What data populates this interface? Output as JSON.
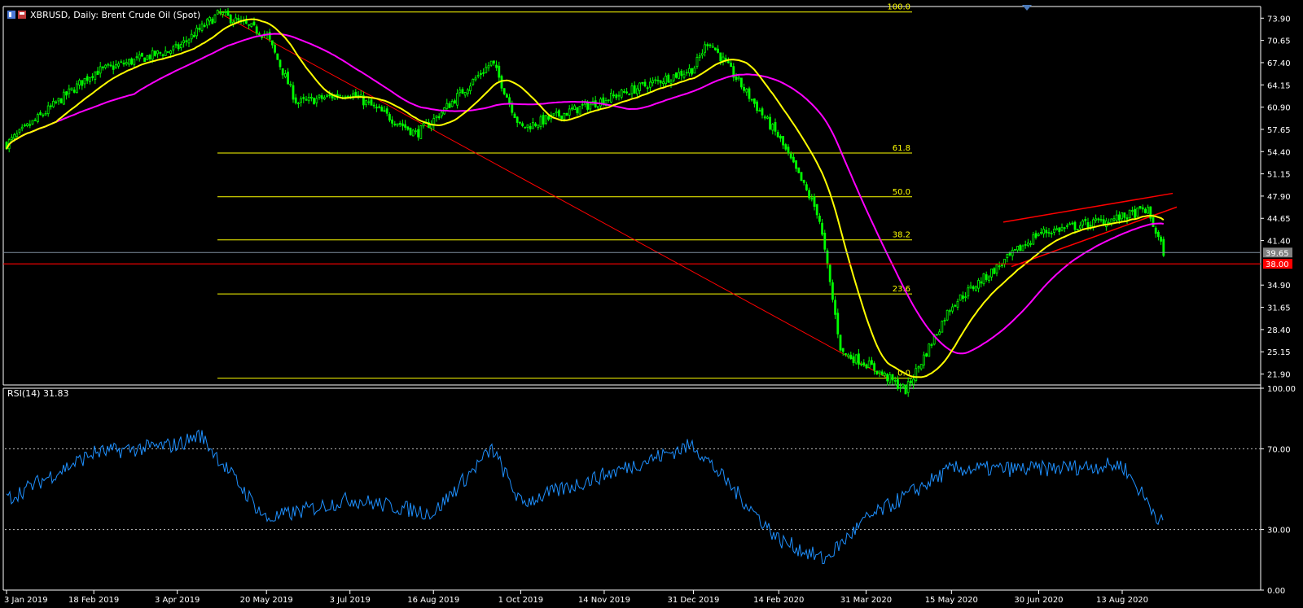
{
  "window": {
    "symbol_title": "XBRUSD, Daily:  Brent Crude Oil (Spot)",
    "rsi_title": "RSI(14) 31.83"
  },
  "price_axis": {
    "ticks": [
      "73.90",
      "70.65",
      "67.40",
      "64.15",
      "60.90",
      "57.65",
      "54.40",
      "51.15",
      "47.90",
      "44.65",
      "41.40",
      "34.90",
      "31.65",
      "28.40",
      "25.15",
      "21.90"
    ],
    "current_price": "39.65",
    "level_label": "38.00"
  },
  "rsi_axis": {
    "ticks": [
      "100.00",
      "70.00",
      "30.00",
      "0.00"
    ]
  },
  "time_axis": {
    "ticks": [
      "3 Jan 2019",
      "18 Feb 2019",
      "3 Apr 2019",
      "20 May 2019",
      "3 Jul 2019",
      "16 Aug 2019",
      "1 Oct 2019",
      "14 Nov 2019",
      "31 Dec 2019",
      "14 Feb 2020",
      "31 Mar 2020",
      "15 May 2020",
      "30 Jun 2020",
      "13 Aug 2020"
    ]
  },
  "fibonacci": {
    "levels": [
      {
        "label": "100.0",
        "price": 74.8
      },
      {
        "label": "61.8",
        "price": 54.2
      },
      {
        "label": "50.0",
        "price": 47.8
      },
      {
        "label": "38.2",
        "price": 41.5
      },
      {
        "label": "23.6",
        "price": 33.6
      },
      {
        "label": "0.0",
        "price": 21.3
      }
    ]
  },
  "colors": {
    "background": "#000000",
    "candle": "#00ff00",
    "ma_fast": "#ffff00",
    "ma_slow": "#ff00ff",
    "trendline": "#ff0000",
    "fib": "#ffff00",
    "rsi_line": "#1e90ff",
    "grid_dots": "#c0c0c0",
    "current_price_bg": "#808080",
    "level_bg": "#ff0000"
  },
  "chart_data": [
    {
      "type": "candlestick",
      "title": "XBRUSD, Daily:  Brent Crude Oil (Spot)",
      "x_range": [
        "3 Jan 2019",
        "Sep 2020"
      ],
      "ylim": [
        20.3,
        75.6
      ],
      "key_points": [
        {
          "date": "3 Jan 2019",
          "close": 55.5
        },
        {
          "date": "18 Feb 2019",
          "close": 66.0
        },
        {
          "date": "3 Apr 2019",
          "close": 69.5
        },
        {
          "date": "25 Apr 2019",
          "close": 74.6
        },
        {
          "date": "20 May 2019",
          "close": 71.5
        },
        {
          "date": "5 Jun 2019",
          "close": 61.5
        },
        {
          "date": "3 Jul 2019",
          "close": 63.0
        },
        {
          "date": "7 Aug 2019",
          "close": 57.0
        },
        {
          "date": "16 Aug 2019",
          "close": 59.0
        },
        {
          "date": "16 Sep 2019",
          "close": 67.5
        },
        {
          "date": "1 Oct 2019",
          "close": 57.8
        },
        {
          "date": "14 Nov 2019",
          "close": 62.0
        },
        {
          "date": "31 Dec 2019",
          "close": 66.5
        },
        {
          "date": "8 Jan 2020",
          "close": 70.7
        },
        {
          "date": "14 Feb 2020",
          "close": 56.5
        },
        {
          "date": "6 Mar 2020",
          "close": 45.2
        },
        {
          "date": "18 Mar 2020",
          "close": 25.0
        },
        {
          "date": "31 Mar 2020",
          "close": 23.5
        },
        {
          "date": "21 Apr 2020",
          "close": 19.5
        },
        {
          "date": "15 May 2020",
          "close": 32.0
        },
        {
          "date": "30 Jun 2020",
          "close": 42.5
        },
        {
          "date": "13 Aug 2020",
          "close": 44.8
        },
        {
          "date": "26 Aug 2020",
          "close": 46.0
        },
        {
          "date": "4 Sep 2020",
          "close": 39.65
        }
      ],
      "moving_averages": [
        {
          "name": "fast",
          "color": "#ffff00"
        },
        {
          "name": "slow",
          "color": "#ff00ff"
        }
      ],
      "horizontal_level": 38.0
    },
    {
      "type": "line",
      "title": "RSI(14) 31.83",
      "ylim": [
        0,
        100
      ],
      "levels": [
        70,
        30
      ],
      "key_points": [
        {
          "date": "3 Jan 2019",
          "value": 45
        },
        {
          "date": "18 Feb 2019",
          "value": 68
        },
        {
          "date": "3 Apr 2019",
          "value": 72
        },
        {
          "date": "15 Apr 2019",
          "value": 77
        },
        {
          "date": "20 May 2019",
          "value": 35
        },
        {
          "date": "3 Jul 2019",
          "value": 45
        },
        {
          "date": "16 Aug 2019",
          "value": 38
        },
        {
          "date": "16 Sep 2019",
          "value": 70
        },
        {
          "date": "1 Oct 2019",
          "value": 43
        },
        {
          "date": "14 Nov 2019",
          "value": 57
        },
        {
          "date": "31 Dec 2019",
          "value": 72
        },
        {
          "date": "14 Feb 2020",
          "value": 25
        },
        {
          "date": "9 Mar 2020",
          "value": 15
        },
        {
          "date": "31 Mar 2020",
          "value": 35
        },
        {
          "date": "15 May 2020",
          "value": 60
        },
        {
          "date": "30 Jun 2020",
          "value": 60
        },
        {
          "date": "13 Aug 2020",
          "value": 62
        },
        {
          "date": "4 Sep 2020",
          "value": 31.83
        }
      ]
    }
  ]
}
